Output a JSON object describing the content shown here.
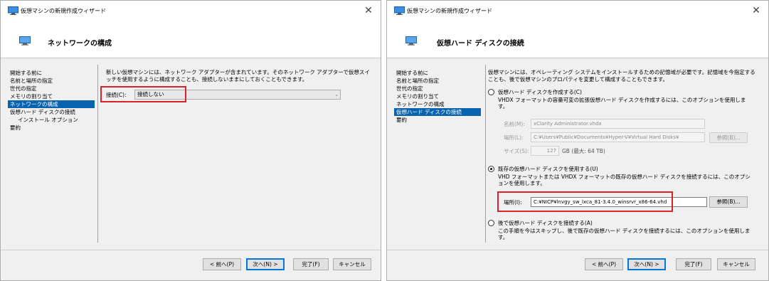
{
  "left": {
    "window_title": "仮想マシンの新規作成ウィザード",
    "page_title": "ネットワークの構成",
    "nav": [
      {
        "label": "開始する前に",
        "selected": false,
        "sub": false
      },
      {
        "label": "名前と場所の指定",
        "selected": false,
        "sub": false
      },
      {
        "label": "世代の指定",
        "selected": false,
        "sub": false
      },
      {
        "label": "メモリの割り当て",
        "selected": false,
        "sub": false
      },
      {
        "label": "ネットワークの構成",
        "selected": true,
        "sub": false
      },
      {
        "label": "仮想ハード ディスクの接続",
        "selected": false,
        "sub": false
      },
      {
        "label": "インストール オプション",
        "selected": false,
        "sub": true
      },
      {
        "label": "要約",
        "selected": false,
        "sub": false
      }
    ],
    "description": "新しい仮想マシンには、ネットワーク アダプターが含まれています。そのネットワーク アダプターで仮想スイッチを使用するように構成することも、接続しないままにしておくこともできます。",
    "connection_label": "接続(C):",
    "connection_value": "接続しない",
    "buttons": {
      "prev": "< 前へ(P)",
      "next": "次へ(N) >",
      "finish": "完了(F)",
      "cancel": "キャンセル"
    }
  },
  "right": {
    "window_title": "仮想マシンの新規作成ウィザード",
    "page_title": "仮想ハード ディスクの接続",
    "nav": [
      {
        "label": "開始する前に",
        "selected": false,
        "sub": false
      },
      {
        "label": "名前と場所の指定",
        "selected": false,
        "sub": false
      },
      {
        "label": "世代の指定",
        "selected": false,
        "sub": false
      },
      {
        "label": "メモリの割り当て",
        "selected": false,
        "sub": false
      },
      {
        "label": "ネットワークの構成",
        "selected": false,
        "sub": false
      },
      {
        "label": "仮想ハード ディスクの接続",
        "selected": true,
        "sub": false
      },
      {
        "label": "要約",
        "selected": false,
        "sub": false
      }
    ],
    "description": "仮想マシンには、オペレーティング システムをインストールするための記憶域が必要です。記憶域を今指定することも、後で仮想マシンのプロパティを変更して構成することもできます。",
    "option_create": {
      "label": "仮想ハード ディスクを作成する(C)",
      "desc": "VHDX フォーマットの容量可変の拡張仮想ハード ディスクを作成するには、このオプションを使用します。",
      "name_label": "名前(M):",
      "name_value": "xClarity Administrator.vhdx",
      "location_label": "場所(L):",
      "location_value": "C:¥Users¥Public¥Documents¥Hyper-V¥Virtual Hard Disks¥",
      "browse_label": "参照(B)...",
      "size_label": "サイズ(S):",
      "size_value": "127",
      "size_suffix": "GB (最大: 64 TB)"
    },
    "option_existing": {
      "label": "既存の仮想ハード ディスクを使用する(U)",
      "desc": "VHD フォーマットまたは VHDX フォーマットの既存の仮想ハード ディスクを接続するには、このオプションを使用します。",
      "location_label": "場所(I):",
      "location_value": "C:¥NICP¥lnvgy_sw_lxca_81-3.4.0_winsrvr_x86-64.vhd",
      "browse_label": "参照(B)..."
    },
    "option_later": {
      "label": "後で仮想ハード ディスクを接続する(A)",
      "desc": "この手順を今はスキップし、後で既存の仮想ハード ディスクを接続するには、このオプションを使用します。"
    },
    "buttons": {
      "prev": "< 前へ(P)",
      "next": "次へ(N) >",
      "finish": "完了(F)",
      "cancel": "キャンセル"
    }
  }
}
